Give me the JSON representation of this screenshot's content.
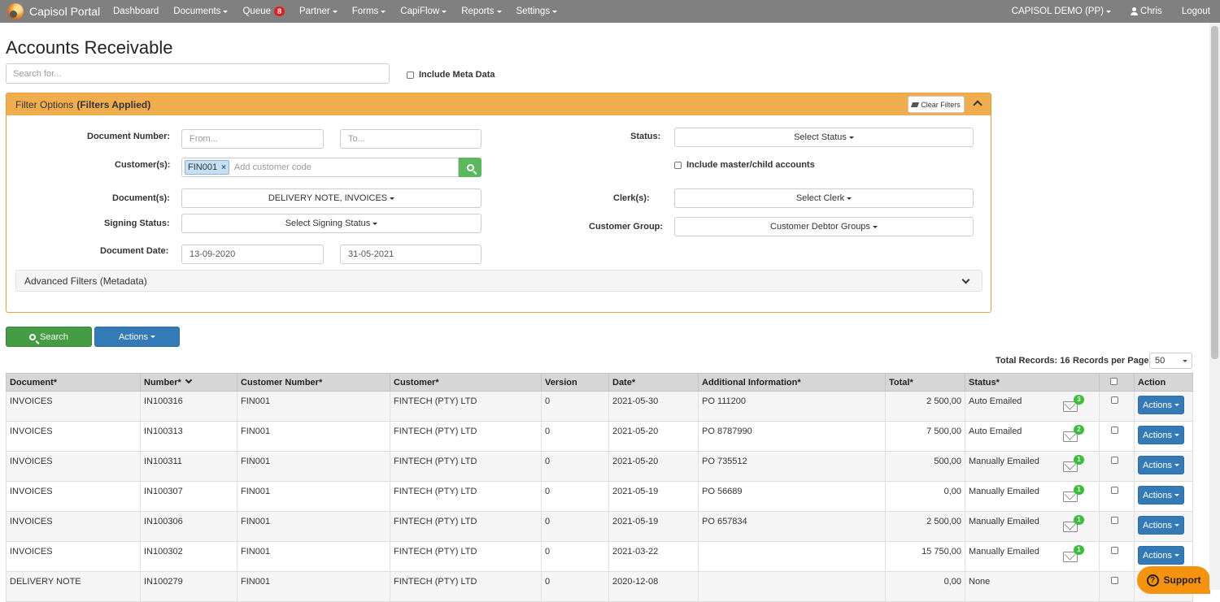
{
  "navbar": {
    "brand": "Capisol Portal",
    "items": [
      {
        "label": "Dashboard",
        "dropdown": false
      },
      {
        "label": "Documents",
        "dropdown": true
      },
      {
        "label": "Queue",
        "dropdown": false,
        "badge": "8"
      },
      {
        "label": "Partner",
        "dropdown": true
      },
      {
        "label": "Forms",
        "dropdown": true
      },
      {
        "label": "CapiFlow",
        "dropdown": true
      },
      {
        "label": "Reports",
        "dropdown": true
      },
      {
        "label": "Settings",
        "dropdown": true
      }
    ],
    "company": "CAPISOL DEMO (PP)",
    "user": "Chris",
    "logout": "Logout"
  },
  "page": {
    "title": "Accounts Receivable",
    "search_placeholder": "Search for...",
    "include_meta": "Include Meta Data"
  },
  "filters": {
    "header": "Filter Options",
    "applied": "(Filters Applied)",
    "clear": "Clear Filters",
    "labels": {
      "document_number": "Document Number:",
      "customers": "Customer(s):",
      "documents": "Document(s):",
      "signing_status": "Signing Status:",
      "document_date": "Document Date:",
      "status": "Status:",
      "clerks": "Clerk(s):",
      "customer_group": "Customer Group:"
    },
    "from_placeholder": "From...",
    "to_placeholder": "To...",
    "customer_tag": "FIN001",
    "customer_placeholder": "Add customer code",
    "documents_value": "DELIVERY NOTE, INVOICES",
    "signing_value": "Select Signing Status",
    "date_from": "13-09-2020",
    "date_to": "31-05-2021",
    "status_value": "Select Status",
    "master_child": "Include master/child accounts",
    "clerk_value": "Select Clerk",
    "group_value": "Customer Debtor Groups",
    "advanced": "Advanced Filters (Metadata)"
  },
  "actions": {
    "search": "Search",
    "actions": "Actions"
  },
  "summary": {
    "total_records": "Total Records: 16",
    "per_page_label": "Records per Page:",
    "per_page_value": "50"
  },
  "table": {
    "headers": [
      "Document*",
      "Number*",
      "Customer Number*",
      "Customer*",
      "Version",
      "Date*",
      "Additional Information*",
      "Total*",
      "Status*",
      "",
      "Action"
    ],
    "row_action": "Actions",
    "rows": [
      {
        "document": "INVOICES",
        "number": "IN100316",
        "customer_number": "FIN001",
        "customer": "FINTECH (PTY) LTD",
        "version": "0",
        "date": "2021-05-30",
        "info": "PO 111200",
        "total": "2 500,00",
        "status": "Auto Emailed",
        "mail_count": "3"
      },
      {
        "document": "INVOICES",
        "number": "IN100313",
        "customer_number": "FIN001",
        "customer": "FINTECH (PTY) LTD",
        "version": "0",
        "date": "2021-05-20",
        "info": "PO 8787990",
        "total": "7 500,00",
        "status": "Auto Emailed",
        "mail_count": "2"
      },
      {
        "document": "INVOICES",
        "number": "IN100311",
        "customer_number": "FIN001",
        "customer": "FINTECH (PTY) LTD",
        "version": "0",
        "date": "2021-05-20",
        "info": "PO 735512",
        "total": "500,00",
        "status": "Manually Emailed",
        "mail_count": "1"
      },
      {
        "document": "INVOICES",
        "number": "IN100307",
        "customer_number": "FIN001",
        "customer": "FINTECH (PTY) LTD",
        "version": "0",
        "date": "2021-05-19",
        "info": "PO 56689",
        "total": "0,00",
        "status": "Manually Emailed",
        "mail_count": "1"
      },
      {
        "document": "INVOICES",
        "number": "IN100306",
        "customer_number": "FIN001",
        "customer": "FINTECH (PTY) LTD",
        "version": "0",
        "date": "2021-05-19",
        "info": "PO 657834",
        "total": "2 500,00",
        "status": "Manually Emailed",
        "mail_count": "1"
      },
      {
        "document": "INVOICES",
        "number": "IN100302",
        "customer_number": "FIN001",
        "customer": "FINTECH (PTY) LTD",
        "version": "0",
        "date": "2021-03-22",
        "info": "",
        "total": "15 750,00",
        "status": "Manually Emailed",
        "mail_count": "1"
      },
      {
        "document": "DELIVERY NOTE",
        "number": "IN100279",
        "customer_number": "FIN001",
        "customer": "FINTECH (PTY) LTD",
        "version": "0",
        "date": "2020-12-08",
        "info": "",
        "total": "0,00",
        "status": "None",
        "mail_count": ""
      }
    ]
  },
  "support": "Support",
  "colors": {
    "navbar": "#808080",
    "filter_header": "#f0ad4e",
    "primary": "#337ab7",
    "success": "#449d44",
    "support": "#f5920e"
  }
}
